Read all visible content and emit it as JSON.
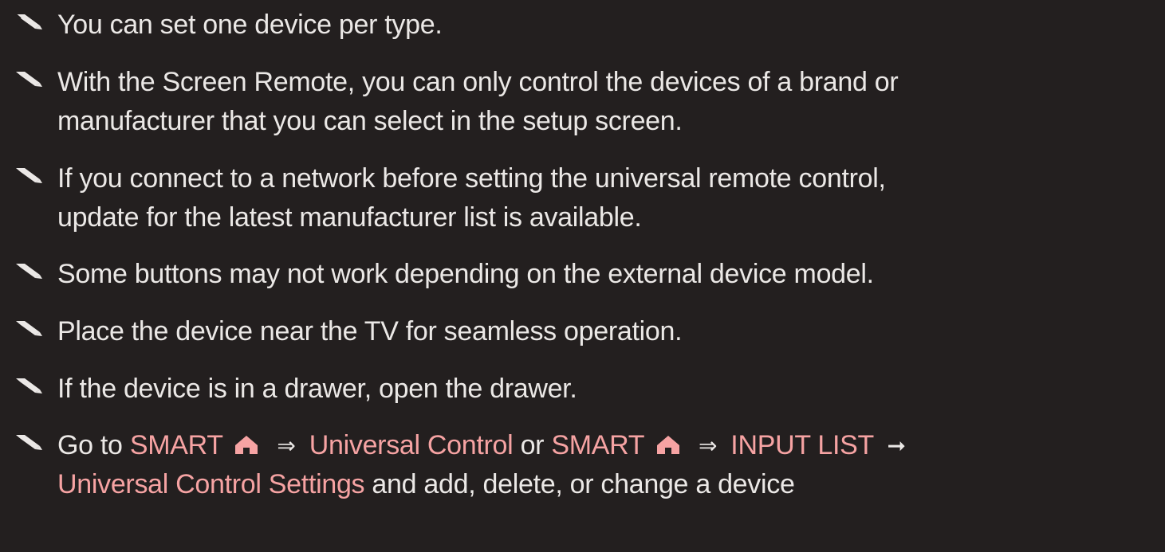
{
  "notes": [
    {
      "text_lines": [
        "You can set one device per type."
      ]
    },
    {
      "text_lines": [
        "With the Screen Remote, you can only control the devices of a brand or",
        "manufacturer that you can select in the setup screen."
      ]
    },
    {
      "text_lines": [
        "If you connect to a network before setting the universal remote control,",
        "update for the latest manufacturer list is available."
      ]
    },
    {
      "text_lines": [
        "Some buttons may not work depending on the external device model."
      ]
    },
    {
      "text_lines": [
        "Place the device near the TV for seamless operation."
      ]
    },
    {
      "text_lines": [
        "If the device is in a drawer, open the drawer."
      ]
    }
  ],
  "last_note": {
    "go_to": "Go to",
    "smart_1": "SMART",
    "arrow_1": "⇒",
    "universal_control": "Universal Control",
    "or": "or",
    "smart_2": "SMART",
    "arrow_2": "⇒",
    "input_list": "INPUT LIST",
    "arrow_3": "➞",
    "settings": "Universal Control Settings",
    "tail": "and add, delete, or change a device"
  },
  "icons": {
    "note": "pencil-icon",
    "home": "home-icon"
  },
  "colors": {
    "background": "#231f1f",
    "text": "#ebe8e6",
    "highlight": "#f6a3a3"
  }
}
